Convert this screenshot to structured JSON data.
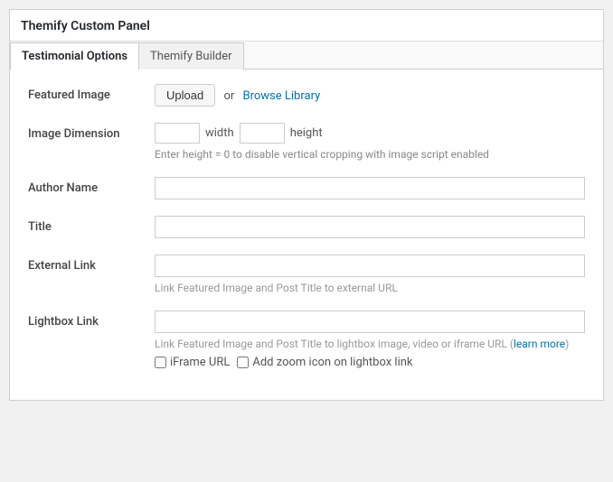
{
  "panel": {
    "title": "Themify Custom Panel",
    "tabs": [
      {
        "id": "testimonial-options",
        "label": "Testimonial Options",
        "active": true
      },
      {
        "id": "themify-builder",
        "label": "Themify Builder",
        "active": false
      }
    ]
  },
  "form": {
    "featured_image": {
      "label": "Featured Image",
      "upload_button": "Upload",
      "or_text": "or",
      "browse_label": "Browse Library"
    },
    "image_dimension": {
      "label": "Image Dimension",
      "width_label": "width",
      "height_label": "height",
      "hint": "Enter height = 0 to disable vertical cropping with image script enabled"
    },
    "author_name": {
      "label": "Author Name",
      "placeholder": ""
    },
    "title": {
      "label": "Title",
      "placeholder": ""
    },
    "external_link": {
      "label": "External Link",
      "placeholder": "",
      "hint": "Link Featured Image and Post Title to external URL"
    },
    "lightbox_link": {
      "label": "Lightbox Link",
      "placeholder": "",
      "hint": "Link Featured Image and Post Title to lightbox image, video or iframe URL",
      "learn_more_label": "learn more",
      "iframe_url_label": "iFrame URL",
      "zoom_label": "Add zoom icon on lightbox link"
    }
  }
}
